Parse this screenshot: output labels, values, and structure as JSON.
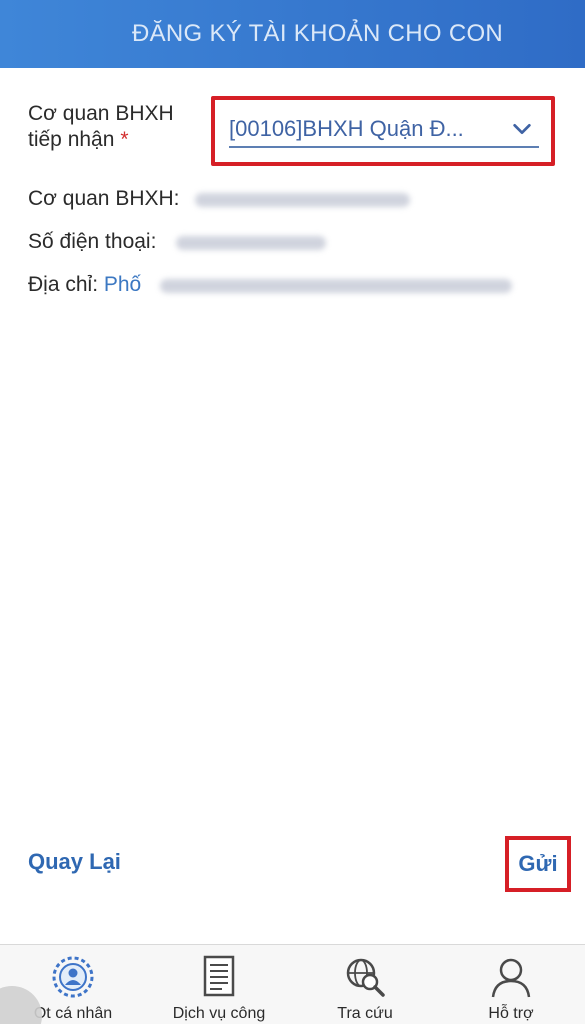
{
  "header": {
    "title": "ĐĂNG KÝ TÀI KHOẢN CHO CON"
  },
  "form": {
    "agency_label": "Cơ quan BHXH tiếp nhận",
    "required_mark": "*",
    "agency_select_value": "[00106]BHXH Quận Đ...",
    "agency_info_label": "Cơ quan BHXH:",
    "phone_label": "Số điện thoại:",
    "address_label": "Địa chỉ:",
    "address_prefix": "Phố"
  },
  "actions": {
    "back_label": "Quay Lại",
    "send_label": "Gửi"
  },
  "tabbar": {
    "tabs": [
      {
        "label": "Ot cá nhân",
        "icon": "personal-account-icon"
      },
      {
        "label": "Dịch vụ công",
        "icon": "document-icon"
      },
      {
        "label": "Tra cứu",
        "icon": "globe-search-icon"
      },
      {
        "label": "Hỗ trợ",
        "icon": "user-support-icon"
      }
    ]
  },
  "colors": {
    "header_blue": "#3f86d8",
    "highlight_red": "#d61f26",
    "link_blue": "#2f68b2"
  }
}
